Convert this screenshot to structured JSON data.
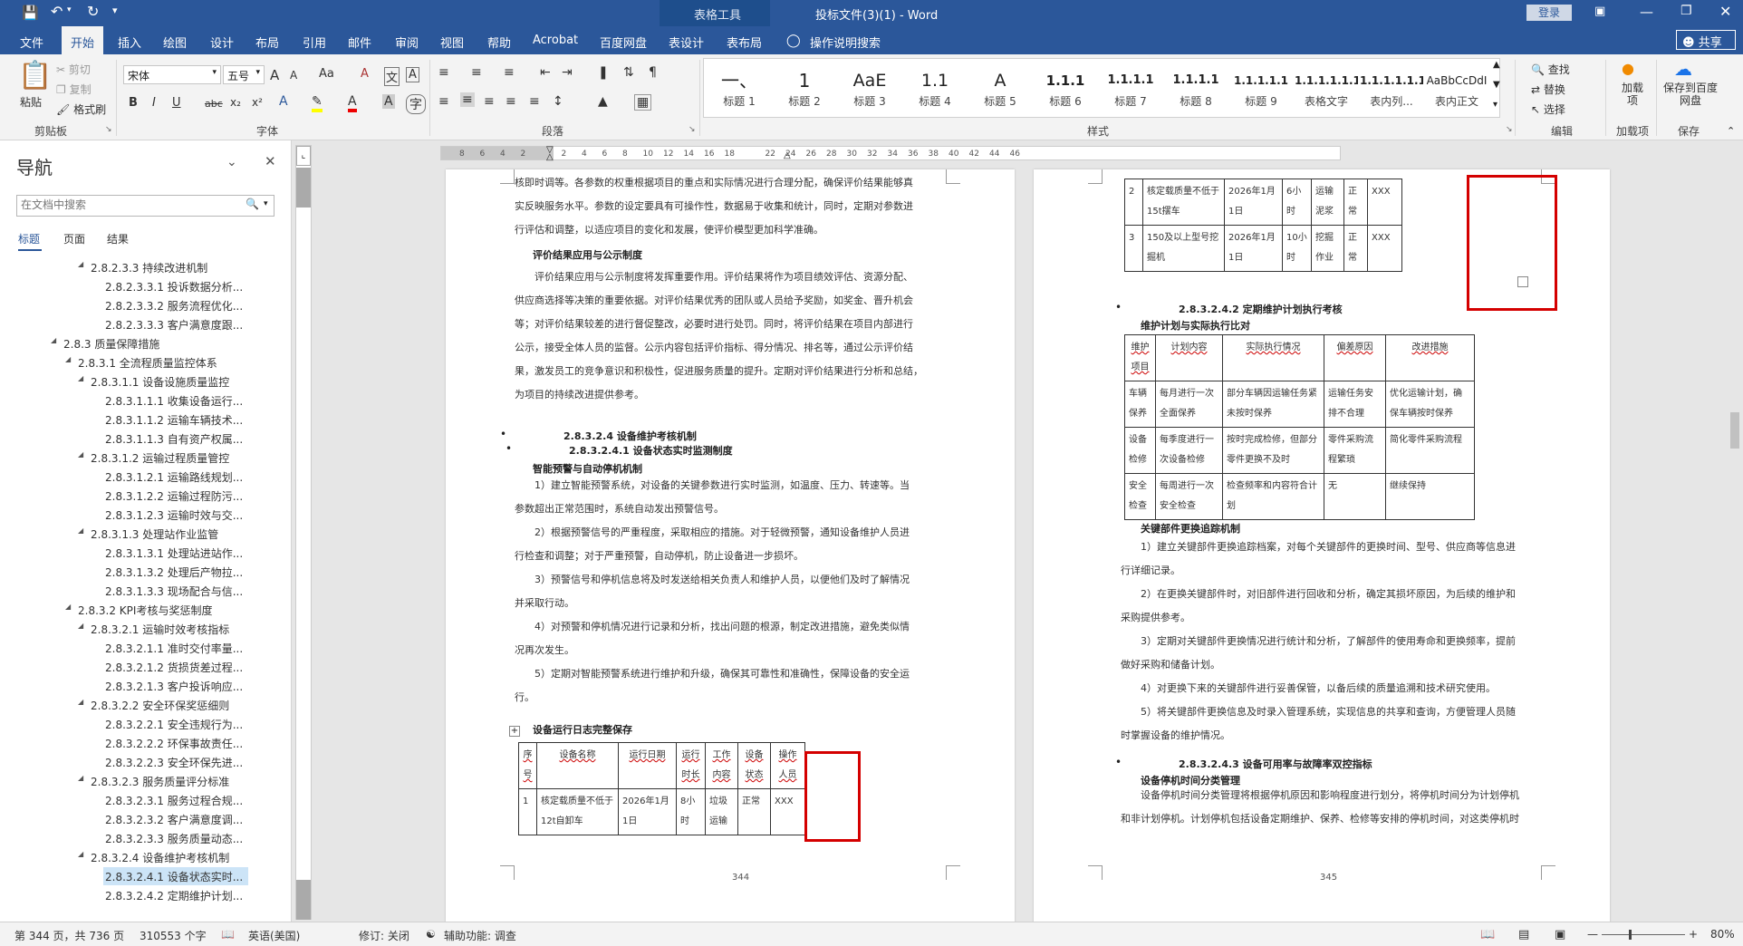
{
  "titlebar": {
    "save_icon": "save-icon",
    "undo_icon": "undo-icon",
    "redo_icon": "redo-icon",
    "customize_icon": "customize-qat-icon",
    "contextual_group": "表格工具",
    "document_title": "投标文件(3)(1)  -  Word",
    "login_label": "登录",
    "colors": {
      "brand": "#2b579a",
      "contextual": "#1e4e8c"
    }
  },
  "tabs": {
    "file": "文件",
    "home": "开始",
    "insert": "插入",
    "draw": "绘图",
    "design": "设计",
    "layout": "布局",
    "references": "引用",
    "mailings": "邮件",
    "review": "审阅",
    "view": "视图",
    "help": "帮助",
    "acrobat": "Acrobat",
    "baidu": "百度网盘",
    "table_design": "表设计",
    "table_layout": "表布局",
    "tell_me": "操作说明搜索",
    "share": "共享"
  },
  "ribbon": {
    "clipboard": {
      "paste": "粘贴",
      "cut": "剪切",
      "copy": "复制",
      "format_painter": "格式刷",
      "label": "剪贴板"
    },
    "font": {
      "name": "宋体",
      "size": "五号",
      "label": "字体",
      "bold": "B",
      "italic": "I",
      "underline": "U",
      "strike": "abc",
      "sub": "x₂",
      "sup": "x²",
      "grow": "A",
      "shrink": "A",
      "case": "Aa",
      "clear": "A",
      "phonetic": "文",
      "border": "A"
    },
    "paragraph": {
      "label": "段落"
    },
    "styles": {
      "label": "样式",
      "items": [
        {
          "preview": "一、",
          "name": "标题 1"
        },
        {
          "preview": "1",
          "name": "标题 2"
        },
        {
          "preview": "AaE",
          "name": "标题 3"
        },
        {
          "preview": "1.1",
          "name": "标题 4"
        },
        {
          "preview": "A",
          "name": "标题 5"
        },
        {
          "preview": "1.1.1",
          "name": "标题 6"
        },
        {
          "preview": "1.1.1.1",
          "name": "标题 7"
        },
        {
          "preview": "1.1.1.1",
          "name": "标题 8"
        },
        {
          "preview": "1.1.1.1.1",
          "name": "标题 9"
        },
        {
          "preview": "1.1.1.1.1.1",
          "name": "表格文字"
        },
        {
          "preview": "1.1.1.1.1.1",
          "name": "表内列..."
        },
        {
          "preview": "AaBbCcDdI",
          "name": "表内正文"
        }
      ]
    },
    "editing": {
      "find": "查找",
      "replace": "替换",
      "select": "选择",
      "label": "编辑"
    },
    "addins": {
      "load": "加载项",
      "label": "加载项"
    },
    "save": {
      "save_baidu": "保存到百度网盘",
      "label": "保存"
    }
  },
  "nav": {
    "title": "导航",
    "search_placeholder": "在文档中搜索",
    "tabs": [
      "标题",
      "页面",
      "结果"
    ],
    "items": [
      {
        "text": "2.8.2.3.3 持续改进机制",
        "level": 4,
        "arrow": "◢"
      },
      {
        "text": "2.8.2.3.3.1 投诉数据分析...",
        "level": 5,
        "arrow": ""
      },
      {
        "text": "2.8.2.3.3.2 服务流程优化...",
        "level": 5,
        "arrow": ""
      },
      {
        "text": "2.8.2.3.3.3 客户满意度跟...",
        "level": 5,
        "arrow": ""
      },
      {
        "text": "2.8.3 质量保障措施",
        "level": 2,
        "arrow": "◢"
      },
      {
        "text": "2.8.3.1 全流程质量监控体系",
        "level": 3,
        "arrow": "◢"
      },
      {
        "text": "2.8.3.1.1 设备设施质量监控",
        "level": 4,
        "arrow": "◢"
      },
      {
        "text": "2.8.3.1.1.1 收集设备运行...",
        "level": 5,
        "arrow": ""
      },
      {
        "text": "2.8.3.1.1.2 运输车辆技术...",
        "level": 5,
        "arrow": ""
      },
      {
        "text": "2.8.3.1.1.3 自有资产权属...",
        "level": 5,
        "arrow": ""
      },
      {
        "text": "2.8.3.1.2 运输过程质量管控",
        "level": 4,
        "arrow": "◢"
      },
      {
        "text": "2.8.3.1.2.1 运输路线规划...",
        "level": 5,
        "arrow": ""
      },
      {
        "text": "2.8.3.1.2.2 运输过程防污...",
        "level": 5,
        "arrow": ""
      },
      {
        "text": "2.8.3.1.2.3 运输时效与交...",
        "level": 5,
        "arrow": ""
      },
      {
        "text": "2.8.3.1.3 处理站作业监管",
        "level": 4,
        "arrow": "◢"
      },
      {
        "text": "2.8.3.1.3.1 处理站进站作...",
        "level": 5,
        "arrow": ""
      },
      {
        "text": "2.8.3.1.3.2 处理后产物拉...",
        "level": 5,
        "arrow": ""
      },
      {
        "text": "2.8.3.1.3.3 现场配合与信...",
        "level": 5,
        "arrow": ""
      },
      {
        "text": "2.8.3.2 KPI考核与奖惩制度",
        "level": 3,
        "arrow": "◢"
      },
      {
        "text": "2.8.3.2.1 运输时效考核指标",
        "level": 4,
        "arrow": "◢"
      },
      {
        "text": "2.8.3.2.1.1 准时交付率量...",
        "level": 5,
        "arrow": ""
      },
      {
        "text": "2.8.3.2.1.2 货损货差过程...",
        "level": 5,
        "arrow": ""
      },
      {
        "text": "2.8.3.2.1.3 客户投诉响应...",
        "level": 5,
        "arrow": ""
      },
      {
        "text": "2.8.3.2.2 安全环保奖惩细则",
        "level": 4,
        "arrow": "◢"
      },
      {
        "text": "2.8.3.2.2.1 安全违规行为...",
        "level": 5,
        "arrow": ""
      },
      {
        "text": "2.8.3.2.2.2 环保事故责任...",
        "level": 5,
        "arrow": ""
      },
      {
        "text": "2.8.3.2.2.3 安全环保先进...",
        "level": 5,
        "arrow": ""
      },
      {
        "text": "2.8.3.2.3 服务质量评分标准",
        "level": 4,
        "arrow": "◢"
      },
      {
        "text": "2.8.3.2.3.1 服务过程合规...",
        "level": 5,
        "arrow": ""
      },
      {
        "text": "2.8.3.2.3.2 客户满意度调...",
        "level": 5,
        "arrow": ""
      },
      {
        "text": "2.8.3.2.3.3 服务质量动态...",
        "level": 5,
        "arrow": ""
      },
      {
        "text": "2.8.3.2.4 设备维护考核机制",
        "level": 4,
        "arrow": "◢"
      },
      {
        "text": "2.8.3.2.4.1 设备状态实时...",
        "level": 5,
        "arrow": "",
        "selected": true
      },
      {
        "text": "2.8.3.2.4.2 定期维护计划...",
        "level": 5,
        "arrow": ""
      }
    ]
  },
  "ruler": {
    "numbers": [
      "8",
      "6",
      "4",
      "2",
      "",
      "2",
      "4",
      "6",
      "8",
      "10",
      "12",
      "14",
      "16",
      "18",
      "",
      "22",
      "24",
      "26",
      "28",
      "30",
      "32",
      "34",
      "36",
      "38",
      "40",
      "42",
      "44",
      "46"
    ]
  },
  "page_left": {
    "paras": [
      "核即时调等。各参数的权重根据项目的重点和实际情况进行合理分配，确保评价结果能够真",
      "实反映服务水平。参数的设定要具有可操作性，数据易于收集和统计，同时，定期对参数进",
      "行评估和调整，以适应项目的变化和发展，使评价模型更加科学准确。"
    ],
    "h1": "评价结果应用与公示制度",
    "paras2": [
      "评价结果应用与公示制度将发挥重要作用。评价结果将作为项目绩效评估、资源分配、",
      "供应商选择等决策的重要依据。对评价结果优秀的团队或人员给予奖励，如奖金、晋升机会",
      "等；对评价结果较差的进行督促整改，必要时进行处罚。同时，将评价结果在项目内部进行",
      "公示，接受全体人员的监督。公示内容包括评价指标、得分情况、排名等，通过公示评价结",
      "果，激发员工的竞争意识和积极性，促进服务质量的提升。定期对评价结果进行分析和总结，",
      "为项目的持续改进提供参考。"
    ],
    "h2": "2.8.3.2.4      设备维护考核机制",
    "h3": "2.8.3.2.4.1 设备状态实时监测制度",
    "h4": "智能预警与自动停机机制",
    "paras3": [
      "1）建立智能预警系统，对设备的关键参数进行实时监测，如温度、压力、转速等。当",
      "参数超出正常范围时，系统自动发出预警信号。",
      "2）根据预警信号的严重程度，采取相应的措施。对于轻微预警，通知设备维护人员进",
      "行检查和调整；对于严重预警，自动停机，防止设备进一步损坏。",
      "3）预警信号和停机信息将及时发送给相关负责人和维护人员，以便他们及时了解情况",
      "并采取行动。",
      "4）对预警和停机情况进行记录和分析，找出问题的根源，制定改进措施，避免类似情",
      "况再次发生。",
      "5）定期对智能预警系统进行维护和升级，确保其可靠性和准确性，保障设备的安全运",
      "行。"
    ],
    "h5": "设备运行日志完整保存",
    "table_head": [
      "序号",
      "设备名称",
      "运行日期",
      "运行时长",
      "工作内容",
      "设备状态",
      "操作人员"
    ],
    "table_rows": [
      [
        "1",
        "核定载质量不低于12t自卸车",
        "2026年1月1日",
        "8小时",
        "垃圾运输",
        "正常",
        "XXX"
      ]
    ],
    "page_no": "344"
  },
  "page_right": {
    "t1_rows": [
      [
        "2",
        "核定载质量不低于15t摆车",
        "2026年1月1日",
        "6小时",
        "运输泥浆",
        "正常",
        "XXX"
      ],
      [
        "3",
        "150及以上型号挖掘机",
        "2026年1月1日",
        "10小时",
        "挖掘作业",
        "正常",
        "XXX"
      ]
    ],
    "h1": "2.8.3.2.4.2 定期维护计划执行考核",
    "h2": "维护计划与实际执行比对",
    "t2_head": [
      "维护项目",
      "计划内容",
      "实际执行情况",
      "偏差原因",
      "改进措施"
    ],
    "t2_rows": [
      [
        "车辆保养",
        "每月进行一次全面保养",
        "部分车辆因运输任务紧未按时保养",
        "运输任务安排不合理",
        "优化运输计划，确保车辆按时保养"
      ],
      [
        "设备检修",
        "每季度进行一次设备检修",
        "按时完成检修，但部分零件更换不及时",
        "零件采购流程繁琐",
        "简化零件采购流程"
      ],
      [
        "安全检查",
        "每周进行一次安全检查",
        "检查频率和内容符合计划",
        "无",
        "继续保持"
      ]
    ],
    "h3": "关键部件更换追踪机制",
    "paras": [
      "1）建立关键部件更换追踪档案，对每个关键部件的更换时间、型号、供应商等信息进",
      "行详细记录。",
      "2）在更换关键部件时，对旧部件进行回收和分析，确定其损坏原因，为后续的维护和",
      "采购提供参考。",
      "3）定期对关键部件更换情况进行统计和分析，了解部件的使用寿命和更换频率，提前",
      "做好采购和储备计划。",
      "4）对更换下来的关键部件进行妥善保管，以备后续的质量追溯和技术研究使用。",
      "5）将关键部件更换信息及时录入管理系统，实现信息的共享和查询，方便管理人员随",
      "时掌握设备的维护情况。"
    ],
    "h4": "2.8.3.2.4.3 设备可用率与故障率双控指标",
    "h5": "设备停机时间分类管理",
    "paras2": [
      "设备停机时间分类管理将根据停机原因和影响程度进行划分，将停机时间分为计划停机",
      "和非计划停机。计划停机包括设备定期维护、保养、检修等安排的停机时间，对这类停机时"
    ],
    "page_no": "345"
  },
  "status": {
    "page": "第 344 页，共 736 页",
    "words": "310553 个字",
    "language": "英语(美国)",
    "track": "修订: 关闭",
    "accessibility": "辅助功能: 调查",
    "zoom": "80%"
  }
}
